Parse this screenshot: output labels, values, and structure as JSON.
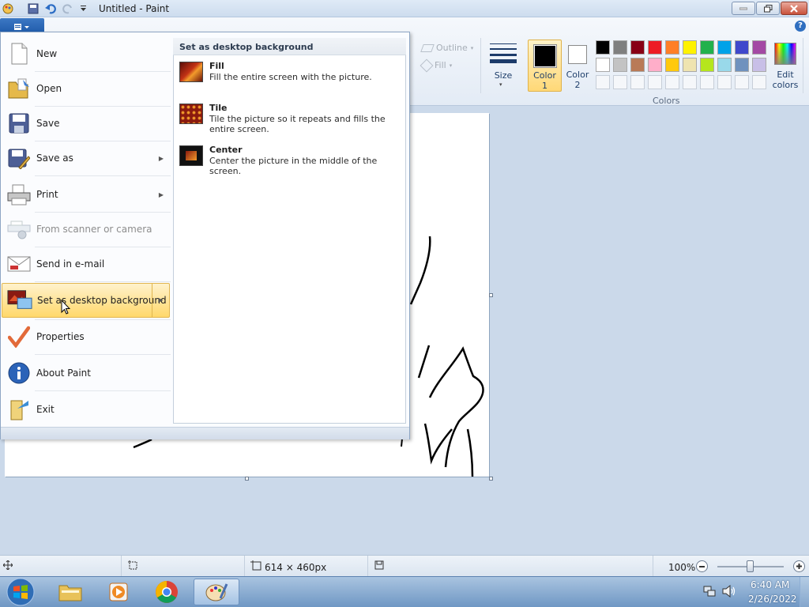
{
  "window": {
    "title": "Untitled - Paint"
  },
  "ribbon": {
    "outline_label": "Outline",
    "fill_label": "Fill",
    "size_label": "Size",
    "color1_label_line1": "Color",
    "color1_label_line2": "1",
    "color2_label_line1": "Color",
    "color2_label_line2": "2",
    "edit_colors_line1": "Edit",
    "edit_colors_line2": "colors",
    "colors_group_label": "Colors",
    "palette_row1": [
      "#000000",
      "#7f7f7f",
      "#880015",
      "#ed1c24",
      "#ff7f27",
      "#fff200",
      "#22b14c",
      "#00a2e8",
      "#3f48cc",
      "#a349a4"
    ],
    "palette_row2": [
      "#ffffff",
      "#c3c3c3",
      "#b97a57",
      "#ffaec9",
      "#ffc90e",
      "#efe4b0",
      "#b5e61d",
      "#99d9ea",
      "#7092be",
      "#c8bfe7"
    ]
  },
  "file_menu": {
    "items": [
      {
        "label": "New"
      },
      {
        "label": "Open"
      },
      {
        "label": "Save"
      },
      {
        "label": "Save as"
      },
      {
        "label": "Print"
      },
      {
        "label": "From scanner or camera"
      },
      {
        "label": "Send in e-mail"
      },
      {
        "label": "Set as desktop background"
      },
      {
        "label": "Properties"
      },
      {
        "label": "About Paint"
      },
      {
        "label": "Exit"
      }
    ],
    "submenu": {
      "header": "Set as desktop background",
      "items": [
        {
          "title": "Fill",
          "description": "Fill the entire screen with the picture."
        },
        {
          "title": "Tile",
          "description": "Tile the picture so it repeats and fills the entire screen."
        },
        {
          "title": "Center",
          "description": "Center the picture in the middle of the screen."
        }
      ]
    }
  },
  "status": {
    "dimensions": "614 × 460px",
    "zoom": "100%"
  },
  "taskbar": {
    "time": "6:40 AM",
    "date": "2/26/2022"
  },
  "colors": {
    "primary": "#000000",
    "secondary": "#ffffff",
    "highlight": "#ffd86b"
  }
}
